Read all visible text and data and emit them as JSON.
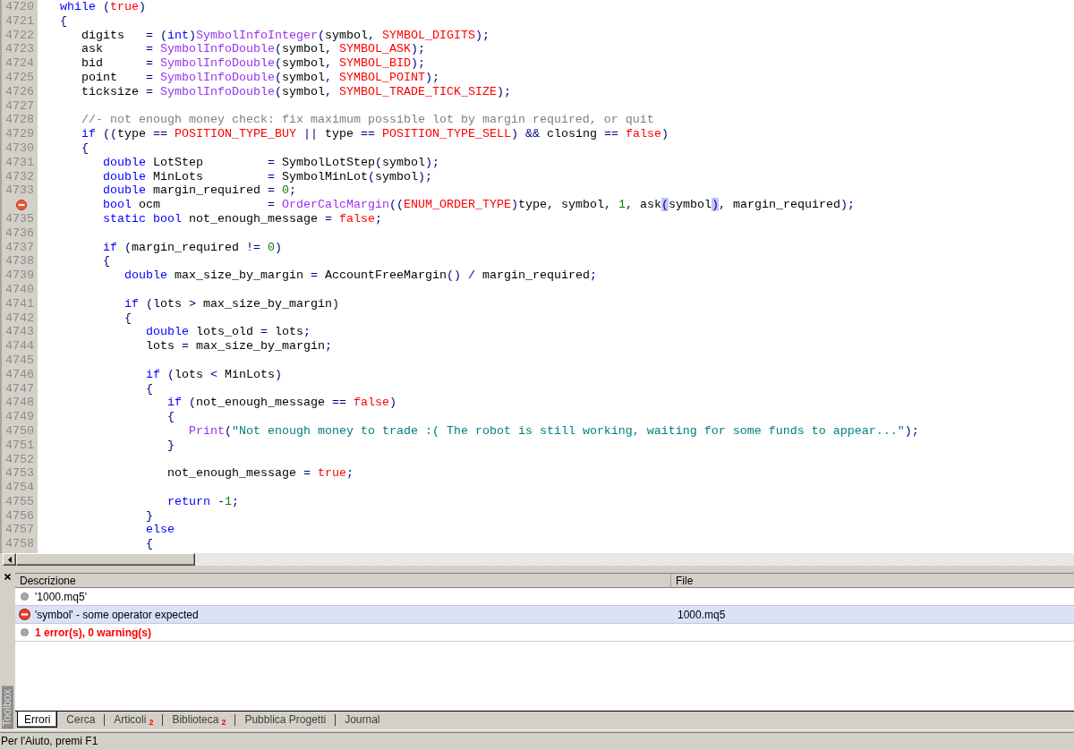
{
  "editor": {
    "lines": [
      {
        "number": "4720",
        "error": false,
        "segments": [
          {
            "text": "while",
            "kind": "keyword"
          },
          {
            "text": " (",
            "kind": "op"
          },
          {
            "text": "true",
            "kind": "constant"
          },
          {
            "text": ")",
            "kind": "op"
          }
        ]
      },
      {
        "number": "4721",
        "error": false,
        "segments": [
          {
            "text": "{",
            "kind": "op"
          }
        ]
      },
      {
        "number": "4722",
        "error": false,
        "segments": [
          {
            "text": "   digits   ",
            "kind": "plain"
          },
          {
            "text": "= (",
            "kind": "op"
          },
          {
            "text": "int",
            "kind": "keyword"
          },
          {
            "text": ")",
            "kind": "op"
          },
          {
            "text": "SymbolInfoInteger",
            "kind": "function"
          },
          {
            "text": "(",
            "kind": "op"
          },
          {
            "text": "symbol",
            "kind": "plain"
          },
          {
            "text": ", ",
            "kind": "op"
          },
          {
            "text": "SYMBOL_DIGITS",
            "kind": "constant"
          },
          {
            "text": ");",
            "kind": "op"
          }
        ]
      },
      {
        "number": "4723",
        "error": false,
        "segments": [
          {
            "text": "   ask      ",
            "kind": "plain"
          },
          {
            "text": "= ",
            "kind": "op"
          },
          {
            "text": "SymbolInfoDouble",
            "kind": "function"
          },
          {
            "text": "(",
            "kind": "op"
          },
          {
            "text": "symbol",
            "kind": "plain"
          },
          {
            "text": ", ",
            "kind": "op"
          },
          {
            "text": "SYMBOL_ASK",
            "kind": "constant"
          },
          {
            "text": ");",
            "kind": "op"
          }
        ]
      },
      {
        "number": "4724",
        "error": false,
        "segments": [
          {
            "text": "   bid      ",
            "kind": "plain"
          },
          {
            "text": "= ",
            "kind": "op"
          },
          {
            "text": "SymbolInfoDouble",
            "kind": "function"
          },
          {
            "text": "(",
            "kind": "op"
          },
          {
            "text": "symbol",
            "kind": "plain"
          },
          {
            "text": ", ",
            "kind": "op"
          },
          {
            "text": "SYMBOL_BID",
            "kind": "constant"
          },
          {
            "text": ");",
            "kind": "op"
          }
        ]
      },
      {
        "number": "4725",
        "error": false,
        "segments": [
          {
            "text": "   point    ",
            "kind": "plain"
          },
          {
            "text": "= ",
            "kind": "op"
          },
          {
            "text": "SymbolInfoDouble",
            "kind": "function"
          },
          {
            "text": "(",
            "kind": "op"
          },
          {
            "text": "symbol",
            "kind": "plain"
          },
          {
            "text": ", ",
            "kind": "op"
          },
          {
            "text": "SYMBOL_POINT",
            "kind": "constant"
          },
          {
            "text": ");",
            "kind": "op"
          }
        ]
      },
      {
        "number": "4726",
        "error": false,
        "segments": [
          {
            "text": "   ticksize ",
            "kind": "plain"
          },
          {
            "text": "= ",
            "kind": "op"
          },
          {
            "text": "SymbolInfoDouble",
            "kind": "function"
          },
          {
            "text": "(",
            "kind": "op"
          },
          {
            "text": "symbol",
            "kind": "plain"
          },
          {
            "text": ", ",
            "kind": "op"
          },
          {
            "text": "SYMBOL_TRADE_TICK_SIZE",
            "kind": "constant"
          },
          {
            "text": ");",
            "kind": "op"
          }
        ]
      },
      {
        "number": "4727",
        "error": false
      },
      {
        "number": "4728",
        "error": false,
        "segments": [
          {
            "text": "   //- not enough money check: fix maximum possible lot by margin required, or quit",
            "kind": "comment"
          }
        ]
      },
      {
        "number": "4729",
        "error": false,
        "segments": [
          {
            "text": "   if",
            "kind": "keyword"
          },
          {
            "text": " ((",
            "kind": "op"
          },
          {
            "text": "type",
            "kind": "plain"
          },
          {
            "text": " == ",
            "kind": "op"
          },
          {
            "text": "POSITION_TYPE_BUY",
            "kind": "constant"
          },
          {
            "text": " || ",
            "kind": "op"
          },
          {
            "text": "type",
            "kind": "plain"
          },
          {
            "text": " == ",
            "kind": "op"
          },
          {
            "text": "POSITION_TYPE_SELL",
            "kind": "constant"
          },
          {
            "text": ") && ",
            "kind": "op"
          },
          {
            "text": "closing",
            "kind": "plain"
          },
          {
            "text": " == ",
            "kind": "op"
          },
          {
            "text": "false",
            "kind": "constant"
          },
          {
            "text": ")",
            "kind": "op"
          }
        ]
      },
      {
        "number": "4730",
        "error": false,
        "segments": [
          {
            "text": "   {",
            "kind": "op"
          }
        ]
      },
      {
        "number": "4731",
        "error": false,
        "segments": [
          {
            "text": "      double",
            "kind": "keyword"
          },
          {
            "text": " LotStep         ",
            "kind": "plain"
          },
          {
            "text": "= ",
            "kind": "op"
          },
          {
            "text": "SymbolLotStep",
            "kind": "plain"
          },
          {
            "text": "(",
            "kind": "op"
          },
          {
            "text": "symbol",
            "kind": "plain"
          },
          {
            "text": ");",
            "kind": "op"
          }
        ]
      },
      {
        "number": "4732",
        "error": false,
        "segments": [
          {
            "text": "      double",
            "kind": "keyword"
          },
          {
            "text": " MinLots         ",
            "kind": "plain"
          },
          {
            "text": "= ",
            "kind": "op"
          },
          {
            "text": "SymbolMinLot",
            "kind": "plain"
          },
          {
            "text": "(",
            "kind": "op"
          },
          {
            "text": "symbol",
            "kind": "plain"
          },
          {
            "text": ");",
            "kind": "op"
          }
        ]
      },
      {
        "number": "4733",
        "error": false,
        "segments": [
          {
            "text": "      double",
            "kind": "keyword"
          },
          {
            "text": " margin_required ",
            "kind": "plain"
          },
          {
            "text": "= ",
            "kind": "op"
          },
          {
            "text": "0",
            "kind": "number"
          },
          {
            "text": ";",
            "kind": "op"
          }
        ]
      },
      {
        "error": true,
        "segments": [
          {
            "text": "      bool",
            "kind": "keyword"
          },
          {
            "text": " ocm               ",
            "kind": "plain"
          },
          {
            "text": "= ",
            "kind": "op"
          },
          {
            "text": "OrderCalcMargin",
            "kind": "function"
          },
          {
            "text": "((",
            "kind": "op"
          },
          {
            "text": "ENUM_ORDER_TYPE",
            "kind": "constant"
          },
          {
            "text": ")",
            "kind": "op"
          },
          {
            "text": "type",
            "kind": "plain"
          },
          {
            "text": ", ",
            "kind": "op"
          },
          {
            "text": "symbol",
            "kind": "plain"
          },
          {
            "text": ", ",
            "kind": "op"
          },
          {
            "text": "1",
            "kind": "number"
          },
          {
            "text": ", ",
            "kind": "op"
          },
          {
            "text": "ask",
            "kind": "plain"
          },
          {
            "text": "(",
            "kind": "brace_match"
          },
          {
            "text": "symbol",
            "kind": "plain"
          },
          {
            "text": ")",
            "kind": "brace_match"
          },
          {
            "text": ", ",
            "kind": "op"
          },
          {
            "text": "margin_required",
            "kind": "plain"
          },
          {
            "text": ");",
            "kind": "op"
          }
        ]
      },
      {
        "number": "4735",
        "error": false,
        "segments": [
          {
            "text": "      static bool",
            "kind": "keyword"
          },
          {
            "text": " not_enough_message ",
            "kind": "plain"
          },
          {
            "text": "= ",
            "kind": "op"
          },
          {
            "text": "false",
            "kind": "constant"
          },
          {
            "text": ";",
            "kind": "op"
          }
        ]
      },
      {
        "number": "4736",
        "error": false
      },
      {
        "number": "4737",
        "error": false,
        "segments": [
          {
            "text": "      if",
            "kind": "keyword"
          },
          {
            "text": " (",
            "kind": "op"
          },
          {
            "text": "margin_required ",
            "kind": "plain"
          },
          {
            "text": "!= ",
            "kind": "op"
          },
          {
            "text": "0",
            "kind": "number"
          },
          {
            "text": ")",
            "kind": "op"
          }
        ]
      },
      {
        "number": "4738",
        "error": false,
        "segments": [
          {
            "text": "      {",
            "kind": "op"
          }
        ]
      },
      {
        "number": "4739",
        "error": false,
        "segments": [
          {
            "text": "         double",
            "kind": "keyword"
          },
          {
            "text": " max_size_by_margin ",
            "kind": "plain"
          },
          {
            "text": "= ",
            "kind": "op"
          },
          {
            "text": "AccountFreeMargin",
            "kind": "plain"
          },
          {
            "text": "() / ",
            "kind": "op"
          },
          {
            "text": "margin_required",
            "kind": "plain"
          },
          {
            "text": ";",
            "kind": "op"
          }
        ]
      },
      {
        "number": "4740",
        "error": false
      },
      {
        "number": "4741",
        "error": false,
        "segments": [
          {
            "text": "         if",
            "kind": "keyword"
          },
          {
            "text": " (",
            "kind": "op"
          },
          {
            "text": "lots ",
            "kind": "plain"
          },
          {
            "text": "> ",
            "kind": "op"
          },
          {
            "text": "max_size_by_margin",
            "kind": "plain"
          },
          {
            "text": ")",
            "kind": "op"
          }
        ]
      },
      {
        "number": "4742",
        "error": false,
        "segments": [
          {
            "text": "         {",
            "kind": "op"
          }
        ]
      },
      {
        "number": "4743",
        "error": false,
        "segments": [
          {
            "text": "            double",
            "kind": "keyword"
          },
          {
            "text": " lots_old ",
            "kind": "plain"
          },
          {
            "text": "= ",
            "kind": "op"
          },
          {
            "text": "lots",
            "kind": "plain"
          },
          {
            "text": ";",
            "kind": "op"
          }
        ]
      },
      {
        "number": "4744",
        "error": false,
        "segments": [
          {
            "text": "            lots ",
            "kind": "plain"
          },
          {
            "text": "= ",
            "kind": "op"
          },
          {
            "text": "max_size_by_margin",
            "kind": "plain"
          },
          {
            "text": ";",
            "kind": "op"
          }
        ]
      },
      {
        "number": "4745",
        "error": false
      },
      {
        "number": "4746",
        "error": false,
        "segments": [
          {
            "text": "            if",
            "kind": "keyword"
          },
          {
            "text": " (",
            "kind": "op"
          },
          {
            "text": "lots ",
            "kind": "plain"
          },
          {
            "text": "< ",
            "kind": "op"
          },
          {
            "text": "MinLots",
            "kind": "plain"
          },
          {
            "text": ")",
            "kind": "op"
          }
        ]
      },
      {
        "number": "4747",
        "error": false,
        "segments": [
          {
            "text": "            {",
            "kind": "op"
          }
        ]
      },
      {
        "number": "4748",
        "error": false,
        "segments": [
          {
            "text": "               if",
            "kind": "keyword"
          },
          {
            "text": " (",
            "kind": "op"
          },
          {
            "text": "not_enough_message ",
            "kind": "plain"
          },
          {
            "text": "== ",
            "kind": "op"
          },
          {
            "text": "false",
            "kind": "constant"
          },
          {
            "text": ")",
            "kind": "op"
          }
        ]
      },
      {
        "number": "4749",
        "error": false,
        "segments": [
          {
            "text": "               {",
            "kind": "op"
          }
        ]
      },
      {
        "number": "4750",
        "error": false,
        "segments": [
          {
            "text": "                  Print",
            "kind": "function"
          },
          {
            "text": "(",
            "kind": "op"
          },
          {
            "text": "\"Not enough money to trade :( The robot is still working, waiting for some funds to appear...\"",
            "kind": "string"
          },
          {
            "text": ");",
            "kind": "op"
          }
        ]
      },
      {
        "number": "4751",
        "error": false,
        "segments": [
          {
            "text": "               }",
            "kind": "op"
          }
        ]
      },
      {
        "number": "4752",
        "error": false
      },
      {
        "number": "4753",
        "error": false,
        "segments": [
          {
            "text": "               not_enough_message ",
            "kind": "plain"
          },
          {
            "text": "= ",
            "kind": "op"
          },
          {
            "text": "true",
            "kind": "constant"
          },
          {
            "text": ";",
            "kind": "op"
          }
        ]
      },
      {
        "number": "4754",
        "error": false
      },
      {
        "number": "4755",
        "error": false,
        "segments": [
          {
            "text": "               return",
            "kind": "keyword"
          },
          {
            "text": " -",
            "kind": "op"
          },
          {
            "text": "1",
            "kind": "number"
          },
          {
            "text": ";",
            "kind": "op"
          }
        ]
      },
      {
        "number": "4756",
        "error": false,
        "segments": [
          {
            "text": "            }",
            "kind": "op"
          }
        ]
      },
      {
        "number": "4757",
        "error": false,
        "segments": [
          {
            "text": "            else",
            "kind": "keyword"
          }
        ]
      },
      {
        "number": "4758",
        "error": false,
        "segments": [
          {
            "text": "            {",
            "kind": "op"
          }
        ]
      }
    ]
  },
  "errors_panel": {
    "columns": [
      "Descrizione",
      "File"
    ],
    "rows": [
      {
        "kind": "info",
        "description": "'1000.mq5'",
        "selected": false
      },
      {
        "kind": "error",
        "description": "'symbol' - some operator expected",
        "file": "1000.mq5",
        "selected": true
      },
      {
        "kind": "summary",
        "description": "1 error(s), 0 warning(s)",
        "selected": false
      }
    ]
  },
  "toolbox": {
    "title": "Toolbox",
    "tabs": [
      {
        "label": "Errori",
        "selected": true
      },
      {
        "label": "Cerca",
        "selected": false
      },
      {
        "label": "Articoli",
        "count": "2",
        "selected": false
      },
      {
        "label": "Biblioteca",
        "count": "2",
        "selected": false
      },
      {
        "label": "Pubblica Progetti",
        "selected": false
      },
      {
        "label": "Journal",
        "selected": false
      }
    ]
  },
  "status_bar": {
    "text": "Per l'Aiuto, premi F1"
  }
}
